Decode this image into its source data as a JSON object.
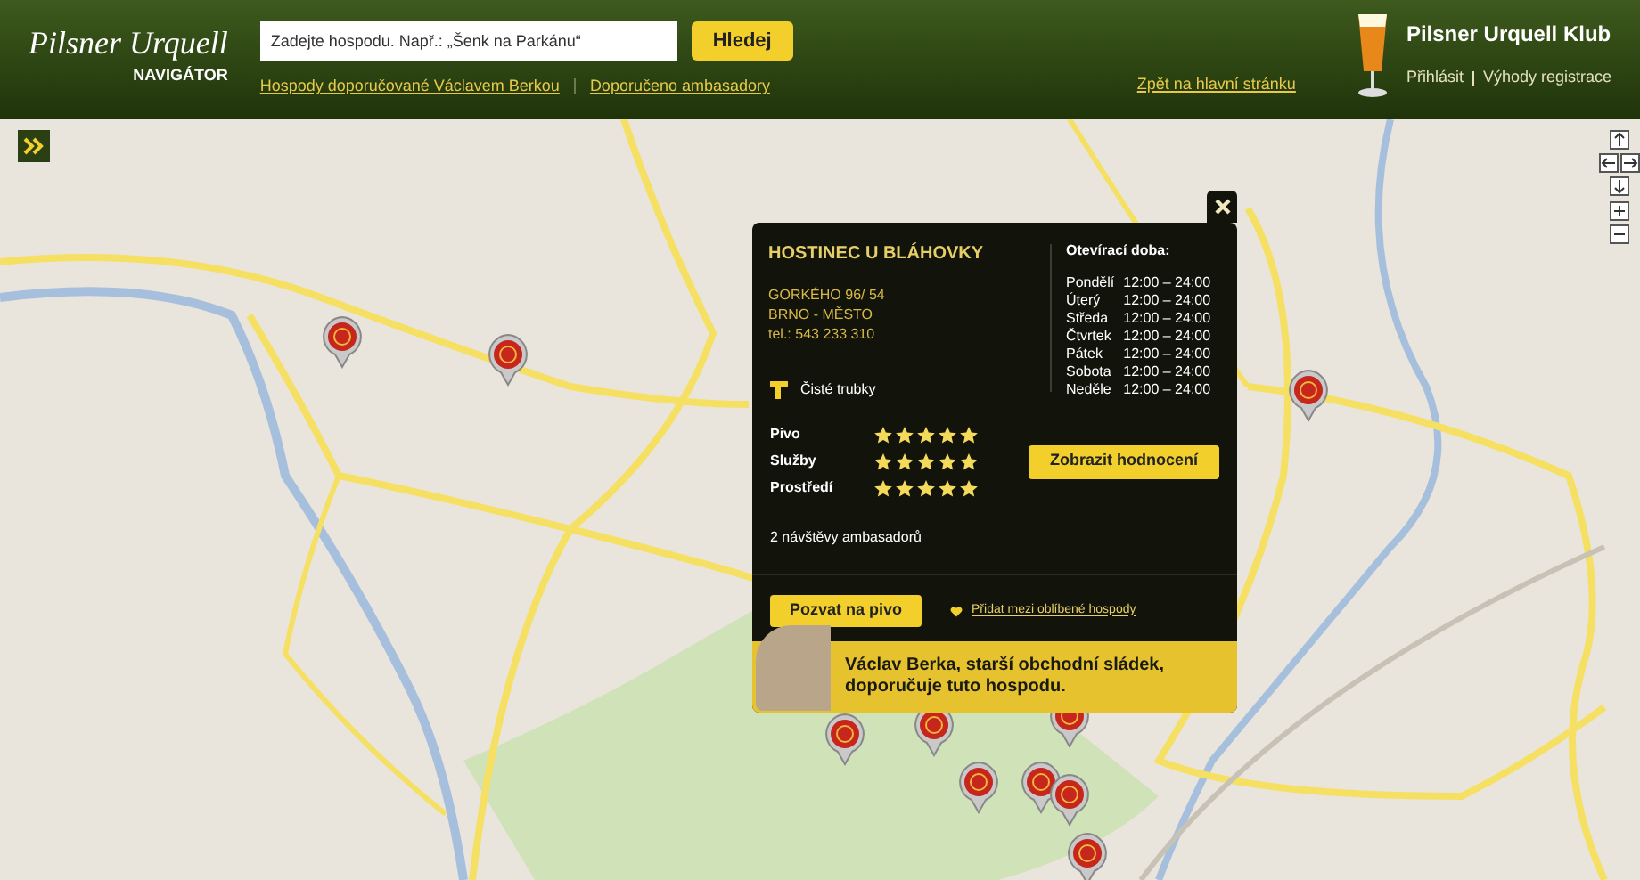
{
  "header": {
    "logo": "Pilsner Urquell",
    "logo_subtitle": "NAVIGÁTOR",
    "search": {
      "placeholder": "Zadejte hospodu. Např.: „Šenk na Parkánu“"
    },
    "search_button": "Hledej",
    "links": [
      "Hospody doporučované Václavem Berkou",
      "Doporučeno ambasadory"
    ],
    "back_link": "Zpět na hlavní stránku",
    "club": {
      "title": "Pilsner Urquell Klub",
      "links": [
        "Přihlásit",
        "Výhody registrace"
      ]
    }
  },
  "popup": {
    "name": "HOSTINEC U BLÁHOVKY",
    "address": [
      "GORKÉHO 96/ 54",
      "BRNO - MĚSTO",
      "tel.: 543 233 310"
    ],
    "feature": "Čisté trubky",
    "hours_title": "Otevírací doba:",
    "hours": [
      {
        "day": "Pondělí",
        "time": "12:00 – 24:00"
      },
      {
        "day": "Úterý",
        "time": "12:00 – 24:00"
      },
      {
        "day": "Středa",
        "time": "12:00 – 24:00"
      },
      {
        "day": "Čtvrtek",
        "time": "12:00 – 24:00"
      },
      {
        "day": "Pátek",
        "time": "12:00 – 24:00"
      },
      {
        "day": "Sobota",
        "time": "12:00 – 24:00"
      },
      {
        "day": "Neděle",
        "time": "12:00 – 24:00"
      }
    ],
    "ratings": [
      {
        "label": "Pivo",
        "stars": 5
      },
      {
        "label": "Služby",
        "stars": 5
      },
      {
        "label": "Prostředí",
        "stars": 5
      }
    ],
    "ratings_button": "Zobrazit hodnocení",
    "visits": "2 návštěvy ambasadorů",
    "invite_button": "Pozvat na pivo",
    "favorite_link": "Přidat mezi oblíbené hospody",
    "recommendation": "Václav Berka, starší obchodní sládek, doporučuje tuto hospodu."
  }
}
